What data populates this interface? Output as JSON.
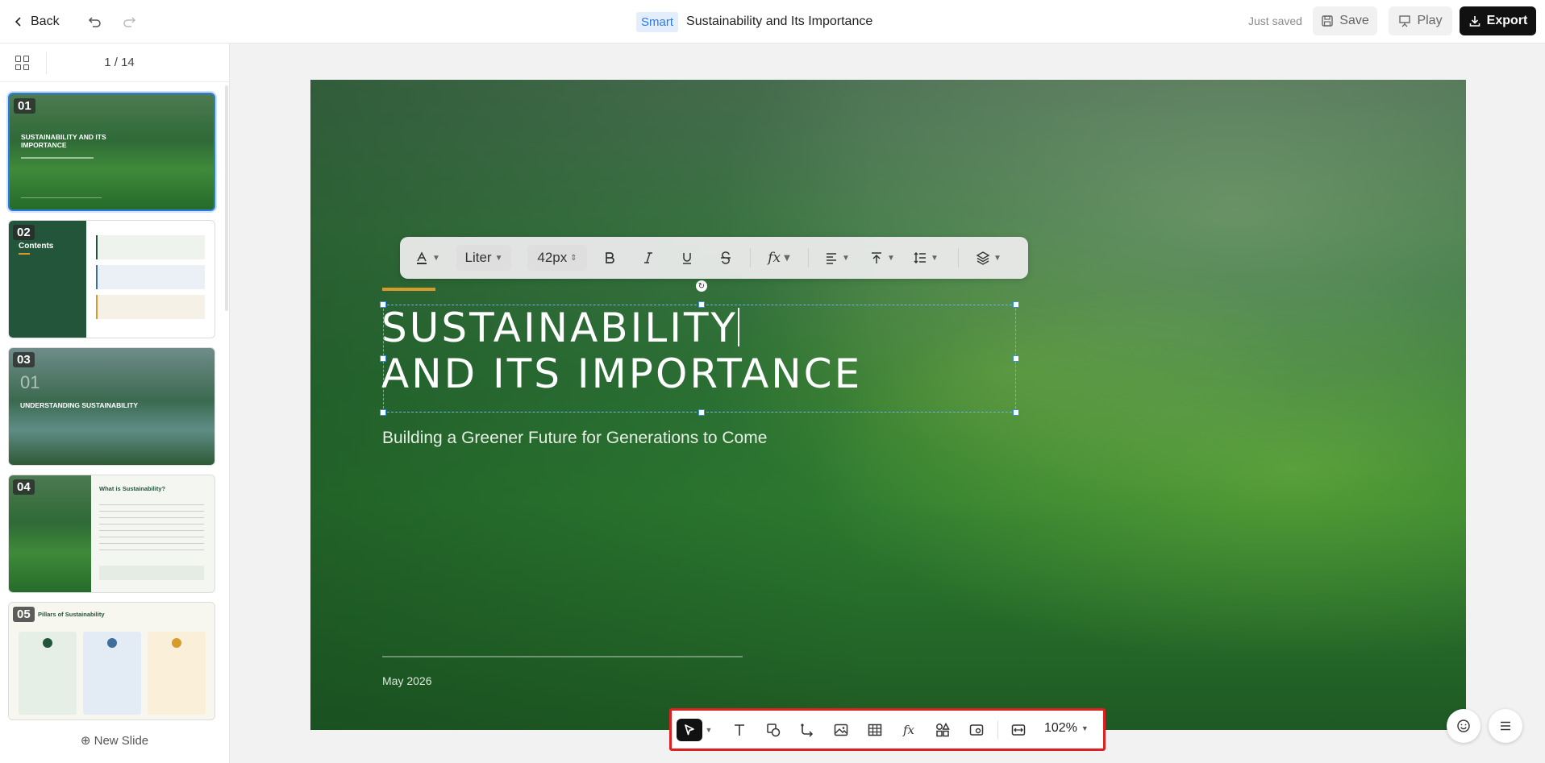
{
  "topbar": {
    "back_label": "Back",
    "badge": "Smart",
    "title": "Sustainability and Its Importance",
    "saved_status": "Just saved",
    "save_label": "Save",
    "play_label": "Play",
    "export_label": "Export"
  },
  "sidebar": {
    "page_counter": "1 / 14",
    "new_slide_label": "New Slide",
    "thumbnails": [
      {
        "num": "01",
        "title": "SUSTAINABILITY AND ITS IMPORTANCE"
      },
      {
        "num": "02",
        "title": "Contents"
      },
      {
        "num": "03",
        "title": "UNDERSTANDING SUSTAINABILITY",
        "big": "01"
      },
      {
        "num": "04",
        "title": "What is Sustainability?"
      },
      {
        "num": "05",
        "title": "Pillars of Sustainability"
      }
    ]
  },
  "slide": {
    "title_line1": "SUSTAINABILITY",
    "title_line2": "AND ITS IMPORTANCE",
    "subtitle": "Building a Greener Future for Generations to Come",
    "date": "May 2026"
  },
  "format_toolbar": {
    "font": "Liter",
    "size": "42px"
  },
  "bottom_toolbar": {
    "zoom": "102%"
  },
  "colors": {
    "accent": "#d79a2b",
    "badge_bg": "#e3eefc",
    "badge_text": "#2d7ae0",
    "export_bg": "#111111",
    "highlight_border": "#e02020"
  }
}
